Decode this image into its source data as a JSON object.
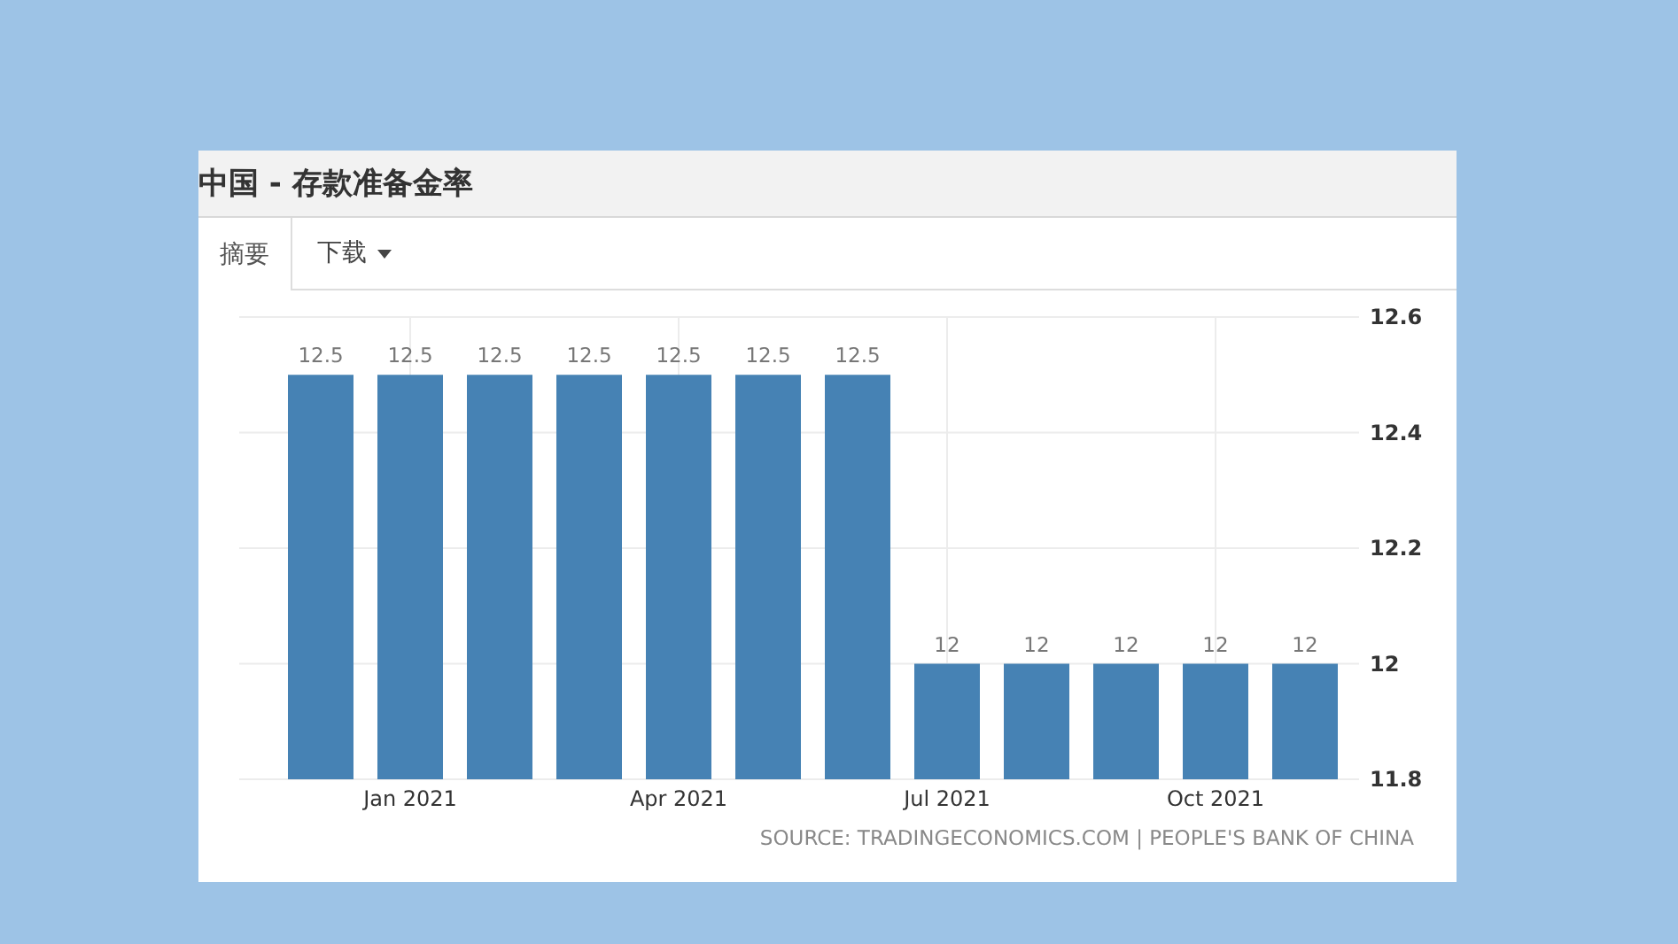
{
  "title": "中国 - 存款准备金率",
  "tabs": [
    {
      "label": "摘要",
      "selected": true,
      "kind": "plain"
    },
    {
      "label": "下载",
      "selected": false,
      "kind": "dropdown"
    }
  ],
  "chart_data": {
    "type": "bar",
    "categories": [
      null,
      "Jan 2021",
      null,
      null,
      "Apr 2021",
      null,
      null,
      "Jul 2021",
      null,
      null,
      "Oct 2021",
      null
    ],
    "values": [
      12.5,
      12.5,
      12.5,
      12.5,
      12.5,
      12.5,
      12.5,
      12,
      12,
      12,
      12,
      12
    ],
    "value_labels": [
      "12.5",
      "12.5",
      "12.5",
      "12.5",
      "12.5",
      "12.5",
      "12.5",
      "12",
      "12",
      "12",
      "12",
      "12"
    ],
    "ylim": [
      11.8,
      12.6
    ],
    "yticks": [
      11.8,
      12,
      12.2,
      12.4,
      12.6
    ],
    "grid": true
  },
  "source": "SOURCE: TRADINGECONOMICS.COM | PEOPLE'S BANK OF CHINA"
}
